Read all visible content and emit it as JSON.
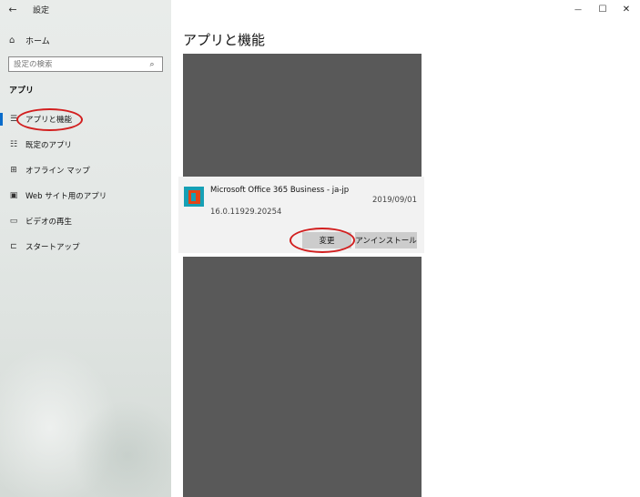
{
  "window": {
    "title": "設定",
    "back_icon": "←",
    "minimize_icon": "—",
    "maximize_icon": "☐",
    "close_icon": "✕"
  },
  "sidebar": {
    "home_label": "ホーム",
    "home_icon": "⌂",
    "search_placeholder": "設定の検索",
    "search_icon": "⌕",
    "section_title": "アプリ",
    "items": [
      {
        "label": "アプリと機能",
        "icon": "☰",
        "selected": true
      },
      {
        "label": "既定のアプリ",
        "icon": "☷"
      },
      {
        "label": "オフライン マップ",
        "icon": "⊞"
      },
      {
        "label": "Web サイト用のアプリ",
        "icon": "▣"
      },
      {
        "label": "ビデオの再生",
        "icon": "▭"
      },
      {
        "label": "スタートアップ",
        "icon": "⊏"
      }
    ]
  },
  "main": {
    "title": "アプリと機能",
    "app": {
      "name": "Microsoft Office 365 Business - ja-jp",
      "date": "2019/09/01",
      "version": "16.0.11929.20254",
      "modify_label": "変更",
      "uninstall_label": "アンインストール"
    }
  },
  "colors": {
    "accent": "#0a6ccb",
    "annotation": "#d21f1f",
    "redacted": "#595959"
  }
}
